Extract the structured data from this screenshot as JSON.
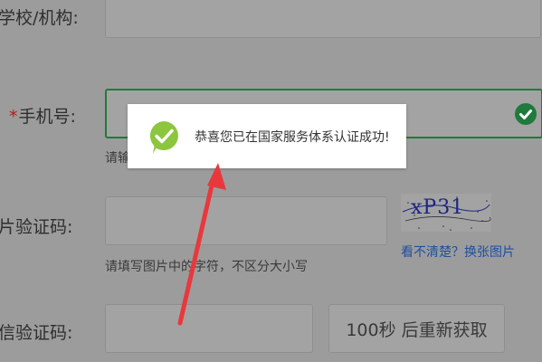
{
  "form": {
    "school": {
      "label": "学校/机构:"
    },
    "phone": {
      "required_mark": "*",
      "label": "手机号:",
      "hint_fragment": "请输",
      "status_icon": "check-circle-icon"
    },
    "image_captcha": {
      "label": "片验证码:",
      "hint": "请填写图片中的字符，不区分大小写",
      "captcha_text": "xP31",
      "refresh_link": "看不清楚？换张图片"
    },
    "sms_code": {
      "label": "信验证码:",
      "button": "100秒 后重新获取"
    }
  },
  "toast": {
    "icon": "success-check-icon",
    "message": "恭喜您已在国家服务体系认证成功!"
  },
  "annotation": {
    "icon": "red-arrow-icon",
    "color": "#e8383d"
  }
}
